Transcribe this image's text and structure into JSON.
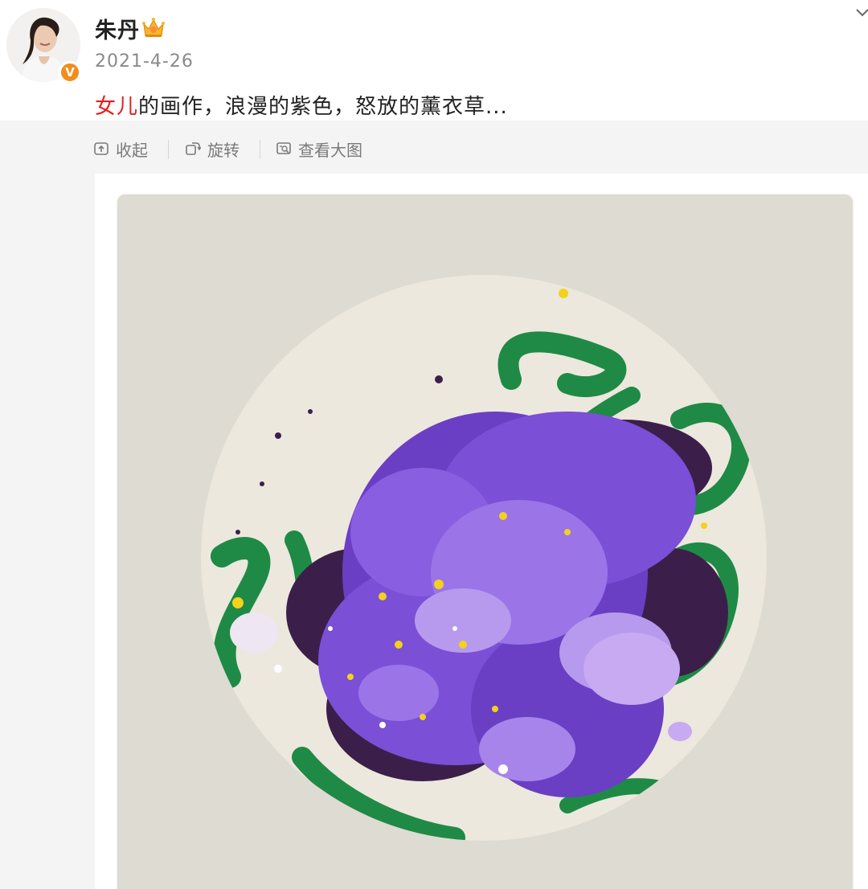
{
  "user": {
    "name": "朱丹",
    "date": "2021-4-26",
    "avatar_icon": "avatar-photo",
    "verified_icon": "verified-v-icon",
    "verified_mark": "V",
    "member_icon": "crown-icon"
  },
  "post": {
    "text_highlight": "女儿",
    "text_rest": "的画作，浪漫的紫色，怒放的薰衣草..."
  },
  "toolbar": {
    "collapse_label": "收起",
    "rotate_label": "旋转",
    "view_large_label": "查看大图"
  },
  "colors": {
    "highlight": "#e02020",
    "badge": "#f28c1b",
    "muted_text": "#8a8a8a",
    "paint_purple": "#7b4fd6",
    "paint_lilac": "#b79aee",
    "paint_green": "#1f8a45",
    "paint_dark": "#3b1f4a",
    "paint_yellow": "#f2d21b"
  }
}
